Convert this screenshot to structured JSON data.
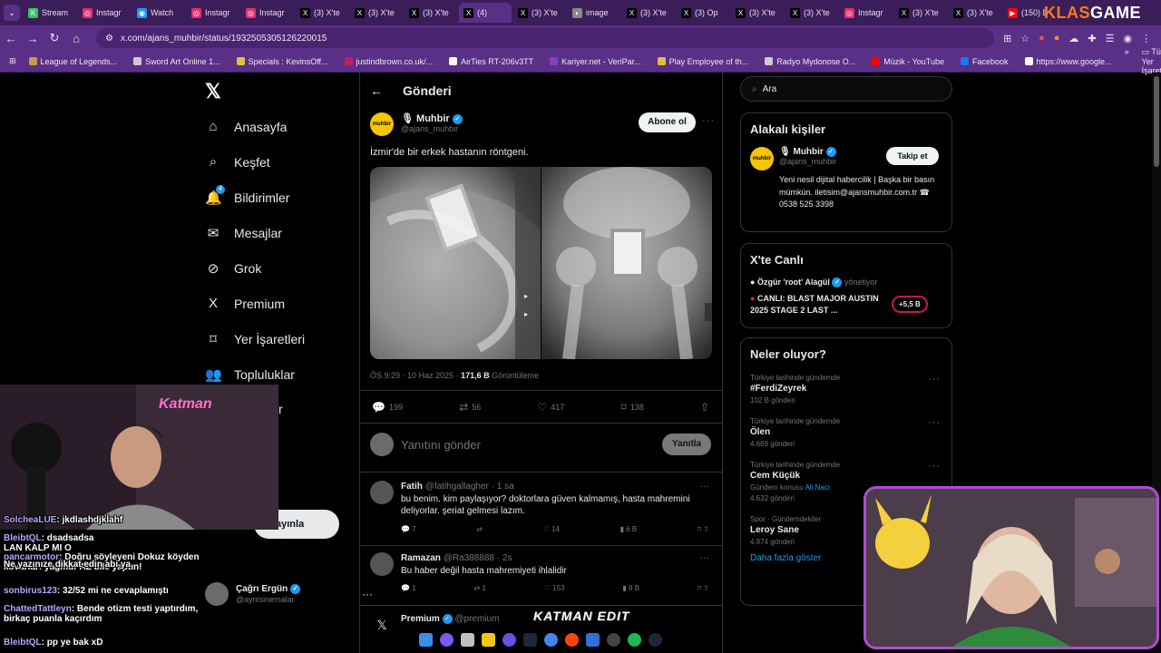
{
  "browser": {
    "tabs": [
      {
        "label": "Stream",
        "color": "#34c759",
        "glyph": "K"
      },
      {
        "label": "Instagr",
        "color": "#e1306c",
        "glyph": "◎"
      },
      {
        "label": "Watch",
        "color": "#1d9bf0",
        "glyph": "◉"
      },
      {
        "label": "Instagr",
        "color": "#e1306c",
        "glyph": "◎"
      },
      {
        "label": "Instagr",
        "color": "#e1306c",
        "glyph": "◎"
      },
      {
        "label": "(3) X'te",
        "color": "#000000",
        "glyph": "X"
      },
      {
        "label": "(3) X'te",
        "color": "#000000",
        "glyph": "X"
      },
      {
        "label": "(3) X'te",
        "color": "#000000",
        "glyph": "X"
      },
      {
        "label": "(4)",
        "color": "#000000",
        "glyph": "X"
      },
      {
        "label": "(3) X'te",
        "color": "#000000",
        "glyph": "X"
      },
      {
        "label": "image",
        "color": "#888888",
        "glyph": "◐"
      },
      {
        "label": "(3) X'te",
        "color": "#000000",
        "glyph": "X"
      },
      {
        "label": "(3) Op",
        "color": "#000000",
        "glyph": "X"
      },
      {
        "label": "(3) X'te",
        "color": "#000000",
        "glyph": "X"
      },
      {
        "label": "(3) X'te",
        "color": "#000000",
        "glyph": "X"
      },
      {
        "label": "Instagr",
        "color": "#e1306c",
        "glyph": "◎"
      },
      {
        "label": "(3) X'te",
        "color": "#000000",
        "glyph": "X"
      },
      {
        "label": "(3) X'te",
        "color": "#000000",
        "glyph": "X"
      },
      {
        "label": "(150) B",
        "color": "#ff0000",
        "glyph": "▶"
      }
    ],
    "url": "x.com/ajans_muhbir/status/1932505305126220015",
    "brand_left": "KLAS",
    "brand_right": "GAME",
    "bookmarks": [
      {
        "label": "League of Legends...",
        "color": "#c89b3c"
      },
      {
        "label": "Sword Art Online 1...",
        "color": "#cccccc"
      },
      {
        "label": "Specials : KevinsOff...",
        "color": "#e0c040"
      },
      {
        "label": "justindbrown.co.uk/...",
        "color": "#c02060"
      },
      {
        "label": "AirTies RT-206v3TT",
        "color": "#ffffff"
      },
      {
        "label": "Kariyer.net - VeriPar...",
        "color": "#8c3cc8"
      },
      {
        "label": "Play Employee of th...",
        "color": "#e0c040"
      },
      {
        "label": "Radyo Mydonose O...",
        "color": "#cccccc"
      },
      {
        "label": "Müzik - YouTube",
        "color": "#ff0000"
      },
      {
        "label": "Facebook",
        "color": "#1877f2"
      },
      {
        "label": "https://www.google...",
        "color": "#ffffff"
      }
    ],
    "bookmarks_all": "Tüm Yer İşaretleri"
  },
  "sidebar": {
    "items": [
      {
        "label": "Anasayfa",
        "icon": "⌂"
      },
      {
        "label": "Keşfet",
        "icon": "⌕"
      },
      {
        "label": "Bildirimler",
        "icon": "🔔"
      },
      {
        "label": "Mesajlar",
        "icon": "✉"
      },
      {
        "label": "Grok",
        "icon": "⊘"
      },
      {
        "label": "Premium",
        "icon": "X"
      },
      {
        "label": "Yer İşaretleri",
        "icon": "⌑"
      },
      {
        "label": "Topluluklar",
        "icon": "👥"
      },
      {
        "label": "uruluşlar",
        "icon": ""
      },
      {
        "label": "la",
        "icon": ""
      }
    ],
    "notification_badge": "4",
    "post_button": "ayınla",
    "account_name": "Çağrı Ergün",
    "account_handle": "@aynisinemalar"
  },
  "post": {
    "header_title": "Gönderi",
    "author_name": "Muhbir",
    "author_handle": "@ajans_muhbir",
    "logo_text": "muhbir",
    "follow_button": "Abone ol",
    "text": "İzmir'de bir erkek hastanın röntgeni.",
    "time": "ÖS 9:29 · 10 Haz 2025 · ",
    "views": "171,6 B",
    "views_label": " Görüntüleme",
    "actions": {
      "replies": "199",
      "reposts": "56",
      "likes": "417",
      "bookmarks": "138"
    },
    "reply_placeholder": "Yanıtını gönder",
    "reply_button": "Yanıtla"
  },
  "replies": [
    {
      "name": "Fatih",
      "handle": "@fatihgallagher · 1 sa",
      "text": "bu benim. kim paylaşıyor? doktorlara güven kalmamış, hasta mahremini deliyorlar. şeriat gelmesi lazım.",
      "replies": "7",
      "reposts": "",
      "likes": "14",
      "views": "6 B"
    },
    {
      "name": "Ramazan",
      "handle": "@Ra388888 · 2s",
      "text": "Bu haber değil hasta mahremiyeti ihlalidir",
      "replies": "1",
      "reposts": "1",
      "likes": "153",
      "views": "9 B"
    },
    {
      "name": "Premium",
      "handle": "@premium",
      "text": "",
      "replies": "",
      "reposts": "",
      "likes": "",
      "views": ""
    }
  ],
  "right": {
    "search_placeholder": "Ara",
    "related_title": "Alakalı kişiler",
    "related_name": "Muhbir",
    "related_handle": "@ajans_muhbir",
    "related_follow": "Takip et",
    "related_bio": "Yeni nesil dijital habercilik | Başka bir basın mümkün. iletisim@ajansmuhbir.com.tr ☎ 0538 525 3398",
    "live_title": "X'te Canlı",
    "live_user": "Özgür 'root' Alagül",
    "live_role": "yönetiyor",
    "live_text": "CANLI: BLAST MAJOR AUSTIN 2025 STAGE 2 LAST ...",
    "live_count": "+5,5 B",
    "trends_title": "Neler oluyor?",
    "trends": [
      {
        "cat": "Türkiye tarihinde gündemde",
        "name": "#FerdiZeyrek",
        "count": "102 B gönderi"
      },
      {
        "cat": "Türkiye tarihinde gündemde",
        "name": "Ölen",
        "count": "4.669 gönderi"
      },
      {
        "cat": "Türkiye tarihinde gündemde",
        "name": "Cem Küçük",
        "count": "4.632 gönderi",
        "extra": "Gündem konusu ",
        "extra_link": "Ali Naci"
      },
      {
        "cat": "Spor · Gündemdekiler",
        "name": "Leroy Sane",
        "count": "4.974 gönderi"
      }
    ],
    "show_more": "Daha fazla göster"
  },
  "overlay": {
    "chat": [
      {
        "user": "SolcheaLUE",
        "msg": ": jkdlashdjklahf"
      },
      {
        "user": "BleibtQL",
        "msg": ": dsadsadsa"
      },
      {
        "user": "",
        "msg": "LAN KALP MI O"
      },
      {
        "user": "pancarmotor",
        "msg": ": Doğru söyleyeni Dokuz köyden kovarlar! yağmur AZ bile yaptın!"
      },
      {
        "user": "",
        "msg": "Ne yazınıze dikkat edin abi ya"
      },
      {
        "user": "sonbirus123",
        "msg": ": 32/52 mi ne cevaplamıştı"
      },
      {
        "user": "ChattedTattleyn",
        "msg": ": Bende otizm testi yaptırdım, birkaç puanla kaçırdım"
      },
      {
        "user": "BleibtQL",
        "msg": ": pp ye bak xD"
      }
    ],
    "streamer_tag": "Katman",
    "watermark": "KATMAN EDIT"
  }
}
